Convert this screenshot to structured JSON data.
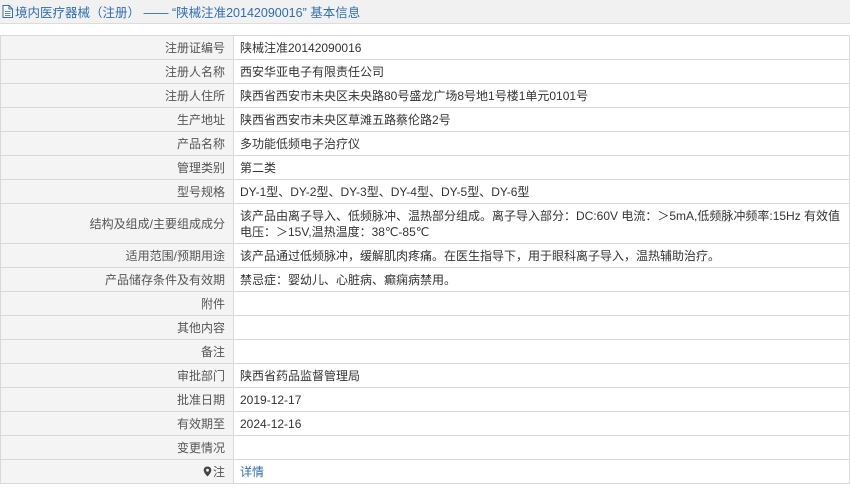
{
  "header": {
    "title": "境内医疗器械（注册） —— “陕械注准20142090016” 基本信息",
    "icon": "document-icon"
  },
  "rows": [
    {
      "label": "注册证编号",
      "value": "陕械注准20142090016"
    },
    {
      "label": "注册人名称",
      "value": "西安华亚电子有限责任公司"
    },
    {
      "label": "注册人住所",
      "value": "陕西省西安市未央区未央路80号盛龙广场8号地1号楼1单元0101号"
    },
    {
      "label": "生产地址",
      "value": "陕西省西安市未央区草滩五路蔡伦路2号"
    },
    {
      "label": "产品名称",
      "value": "多功能低频电子治疗仪"
    },
    {
      "label": "管理类别",
      "value": "第二类"
    },
    {
      "label": "型号规格",
      "value": "DY-1型、DY-2型、DY-3型、DY-4型、DY-5型、DY-6型"
    },
    {
      "label": "结构及组成/主要组成成分",
      "value": "该产品由离子导入、低频脉冲、温热部分组成。离子导入部分：DC:60V 电流：＞5mA,低频脉冲频率:15Hz 有效值电压：＞15V,温热温度：38℃-85℃"
    },
    {
      "label": "适用范围/预期用途",
      "value": "该产品通过低频脉冲，缓解肌肉疼痛。在医生指导下，用于眼科离子导入，温热辅助治疗。"
    },
    {
      "label": "产品储存条件及有效期",
      "value": "禁忌症：婴幼儿、心脏病、癫痫病禁用。"
    },
    {
      "label": "附件",
      "value": ""
    },
    {
      "label": "其他内容",
      "value": ""
    },
    {
      "label": "备注",
      "value": ""
    },
    {
      "label": "审批部门",
      "value": "陕西省药品监督管理局"
    },
    {
      "label": "批准日期",
      "value": "2019-12-17"
    },
    {
      "label": "有效期至",
      "value": "2024-12-16"
    },
    {
      "label": "变更情况",
      "value": ""
    }
  ],
  "note": {
    "label": "注",
    "icon": "map-pin-icon",
    "link_text": "详情"
  },
  "colors": {
    "link": "#2f6db5",
    "label_bg": "#f4f4f4",
    "border": "#d9d9d9"
  }
}
